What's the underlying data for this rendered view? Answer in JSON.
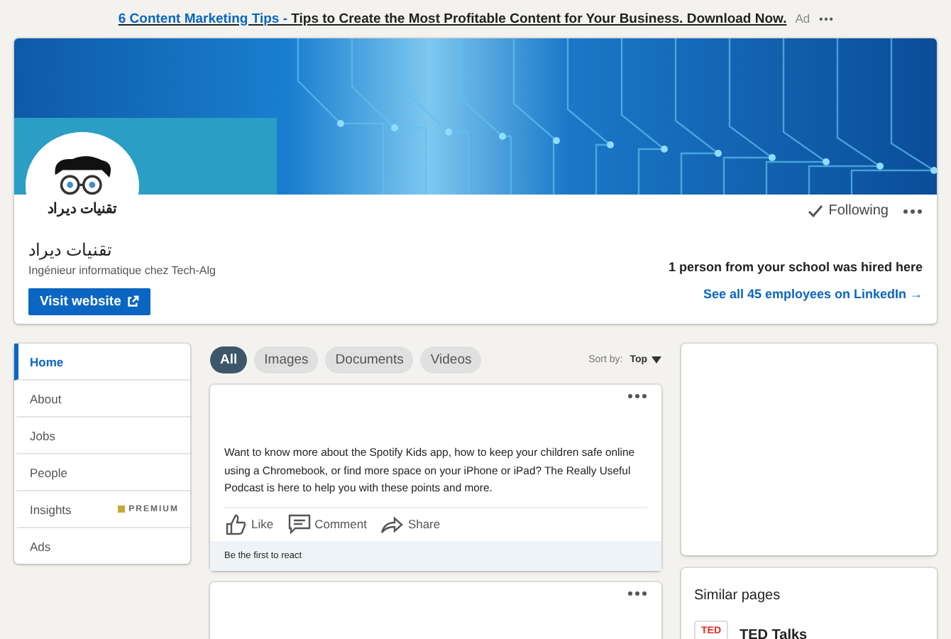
{
  "ad": {
    "link": "6 Content Marketing Tips -",
    "text": "Tips to Create the Most Profitable Content for Your Business. Download Now.",
    "label": "Ad"
  },
  "company": {
    "logo_text": "تقنيات ديراد",
    "name": "تقنيات ديراد",
    "tagline": "Ingénieur informatique chez Tech-Alg",
    "website_button": "Visit website",
    "follow_button": "Following",
    "following": true,
    "hired_note": "1 person from your school was hired here",
    "employees_link": "See all 45 employees on LinkedIn →"
  },
  "sidebar": {
    "items": [
      {
        "label": "Home",
        "selected": true
      },
      {
        "label": "About",
        "selected": false
      },
      {
        "label": "Jobs",
        "selected": false
      },
      {
        "label": "People",
        "selected": false
      },
      {
        "label": "Insights",
        "selected": false,
        "badge": "PREMIUM"
      },
      {
        "label": "Ads",
        "selected": false
      }
    ]
  },
  "filters": [
    {
      "label": "All",
      "selected": true
    },
    {
      "label": "Images",
      "selected": false
    },
    {
      "label": "Documents",
      "selected": false
    },
    {
      "label": "Videos",
      "selected": false
    }
  ],
  "sort": {
    "label": "Sort by:",
    "value": "Top"
  },
  "posts": [
    {
      "kind": "text",
      "text": "Want to know more about the Spotify Kids app, how to keep your children safe online using a Chromebook, or find more space on your iPhone or iPad? The Really Useful Podcast is here to help you with these points and more.",
      "actions": [
        {
          "kind": "like",
          "label": "Like"
        },
        {
          "kind": "comment",
          "label": "Comment"
        },
        {
          "kind": "share",
          "label": "Share"
        }
      ],
      "footer": "Be the first to react"
    },
    {
      "kind": "empty"
    }
  ],
  "similar_pages": {
    "title": "Similar pages",
    "items": [
      {
        "logo_text": "TED",
        "name": "TED Talks"
      }
    ]
  }
}
